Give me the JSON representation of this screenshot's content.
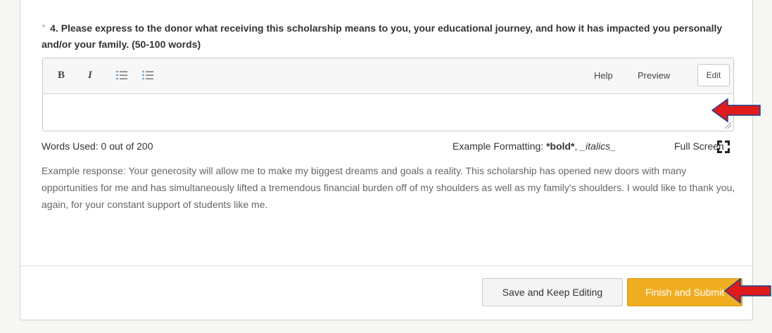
{
  "question": {
    "asterisk": "*",
    "text": "4. Please express to the donor what receiving this scholarship means to you, your educational journey, and how it has impacted you personally and/or your family. (50-100 words)"
  },
  "toolbar": {
    "bold": "B",
    "italic": "I",
    "ordered_list_icon": "ordered-list-icon",
    "unordered_list_icon": "unordered-list-icon",
    "help": "Help",
    "preview": "Preview",
    "edit": "Edit"
  },
  "editor": {
    "value": ""
  },
  "status": {
    "words_label": "Words Used: ",
    "words_count": "0 out of 200",
    "formatting_label": "Example Formatting: ",
    "formatting_bold": "*bold*",
    "formatting_sep": ", ",
    "formatting_italic": "_italics_",
    "fullscreen": "Full Screen"
  },
  "example": "Example response: Your generosity will allow me to make my biggest dreams and goals a reality. This scholarship has opened new doors with many opportunities for me and has simultaneously lifted a tremendous financial burden off of my shoulders as well as my family's shoulders. I would like to thank you, again, for your constant support of students like me.",
  "actions": {
    "save": "Save and Keep Editing",
    "finish": "Finish and Submit"
  },
  "colors": {
    "accent": "#f0ad20",
    "annotation_arrow": "#e01b1b",
    "arrow_outline": "#1c3f8c"
  }
}
